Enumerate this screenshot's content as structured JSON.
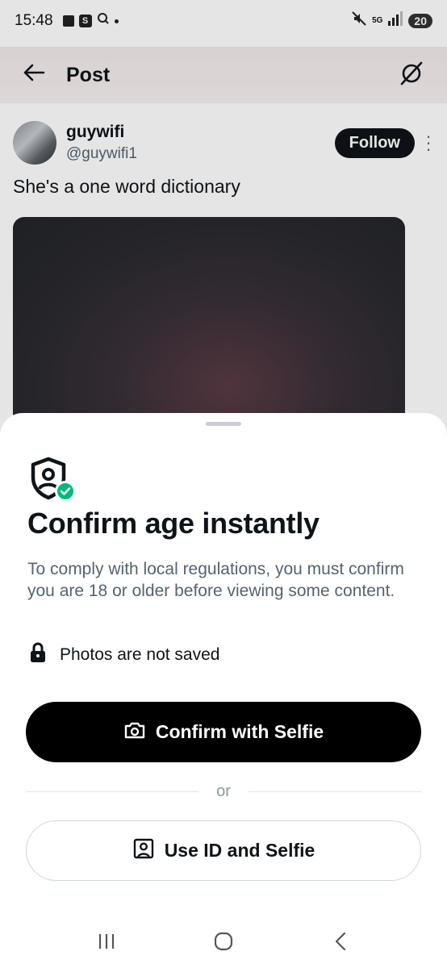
{
  "status_bar": {
    "time": "15:48",
    "network": "5G",
    "battery": "20"
  },
  "header": {
    "back_icon": "arrow-left-icon",
    "title": "Post",
    "grok_icon": "grok-icon"
  },
  "post": {
    "display_name": "guywifi",
    "handle": "@guywifi1",
    "follow_label": "Follow",
    "text": "She's a one word dictionary"
  },
  "sheet": {
    "icon": "shield-user-check-icon",
    "title": "Confirm age instantly",
    "description": "To comply with local regulations, you must confirm you are 18 or older before viewing some content.",
    "notice": "Photos are not saved",
    "primary_button": "Confirm with Selfie",
    "divider": "or",
    "secondary_button": "Use ID and Selfie"
  },
  "colors": {
    "accent_black": "#000000",
    "success_green": "#00ba7c",
    "secondary_text": "#536471"
  }
}
